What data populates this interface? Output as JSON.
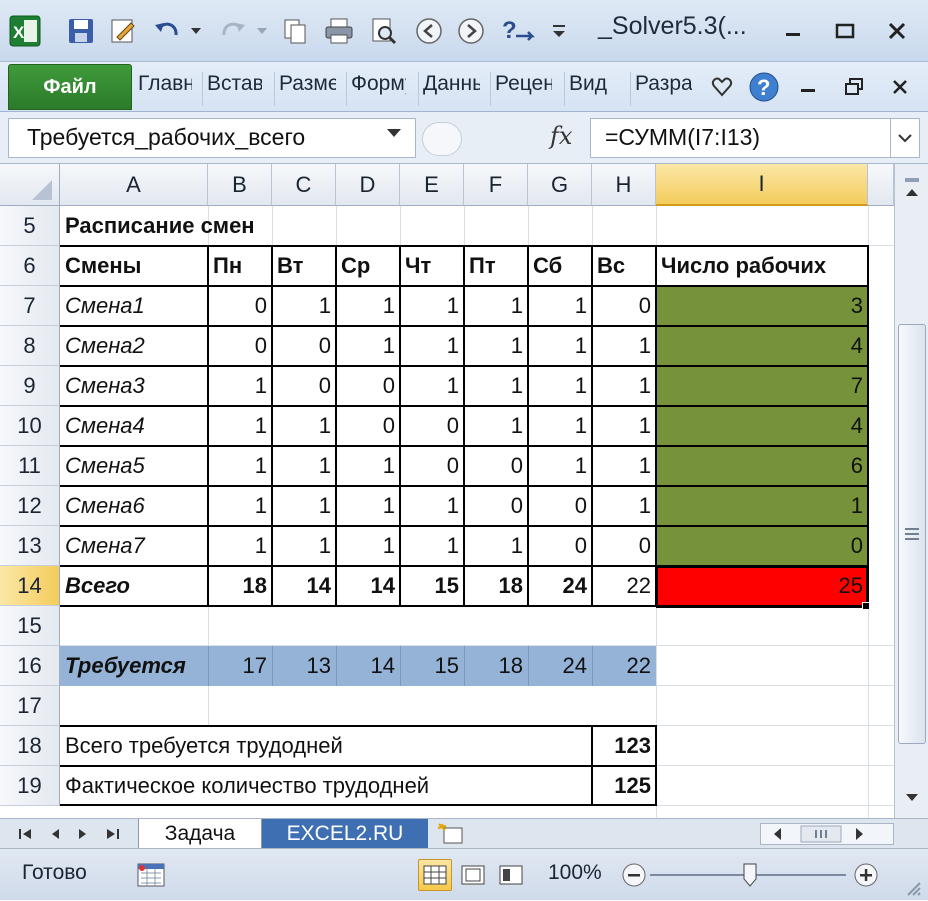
{
  "window": {
    "title": "_Solver5.3(...",
    "colors": {
      "accent_green": "#2c7b2a",
      "workers_fill": "#76933c",
      "total_fill": "#ff0000",
      "required_fill": "#95b3d7"
    }
  },
  "ribbon": {
    "file_tab": "Файл",
    "tabs": [
      "Главная",
      "Вставка",
      "Разметка",
      "Формулы",
      "Данные",
      "Рецензирование",
      "Вид",
      "Разработчик"
    ]
  },
  "formula_bar": {
    "name_box": "Требуется_рабочих_всего",
    "fx_label": "fx",
    "formula": "=СУММ(I7:I13)"
  },
  "sheet": {
    "columns": [
      "A",
      "B",
      "C",
      "D",
      "E",
      "F",
      "G",
      "H",
      "I"
    ],
    "selected_column": "I",
    "rows": [
      "5",
      "6",
      "7",
      "8",
      "9",
      "10",
      "11",
      "12",
      "13",
      "14",
      "15",
      "16",
      "17",
      "18",
      "19"
    ],
    "selected_row": "14",
    "title": "Расписание смен",
    "header": {
      "shift": "Смены",
      "days": [
        "Пн",
        "Вт",
        "Ср",
        "Чт",
        "Пт",
        "Сб",
        "Вс"
      ],
      "workers": "Число рабочих"
    },
    "shifts": [
      {
        "name": "Смена1",
        "days": [
          "0",
          "1",
          "1",
          "1",
          "1",
          "1",
          "0"
        ],
        "workers": "3"
      },
      {
        "name": "Смена2",
        "days": [
          "0",
          "0",
          "1",
          "1",
          "1",
          "1",
          "1"
        ],
        "workers": "4"
      },
      {
        "name": "Смена3",
        "days": [
          "1",
          "0",
          "0",
          "1",
          "1",
          "1",
          "1"
        ],
        "workers": "7"
      },
      {
        "name": "Смена4",
        "days": [
          "1",
          "1",
          "0",
          "0",
          "1",
          "1",
          "1"
        ],
        "workers": "4"
      },
      {
        "name": "Смена5",
        "days": [
          "1",
          "1",
          "1",
          "0",
          "0",
          "1",
          "1"
        ],
        "workers": "6"
      },
      {
        "name": "Смена6",
        "days": [
          "1",
          "1",
          "1",
          "1",
          "0",
          "0",
          "1"
        ],
        "workers": "1"
      },
      {
        "name": "Смена7",
        "days": [
          "1",
          "1",
          "1",
          "1",
          "1",
          "0",
          "0"
        ],
        "workers": "0"
      }
    ],
    "total": {
      "label": "Всего",
      "days": [
        "18",
        "14",
        "14",
        "15",
        "18",
        "24",
        "22"
      ],
      "workers": "25"
    },
    "required": {
      "label": "Требуется",
      "days": [
        "17",
        "13",
        "14",
        "15",
        "18",
        "24",
        "22"
      ]
    },
    "summary": [
      {
        "label": "Всего требуется трудодней",
        "value": "123"
      },
      {
        "label": "Фактическое количество трудодней",
        "value": "125"
      }
    ]
  },
  "sheet_tabs": {
    "active": "Задача",
    "other": "EXCEL2.RU"
  },
  "status": {
    "ready": "Готово",
    "zoom": "100%"
  }
}
